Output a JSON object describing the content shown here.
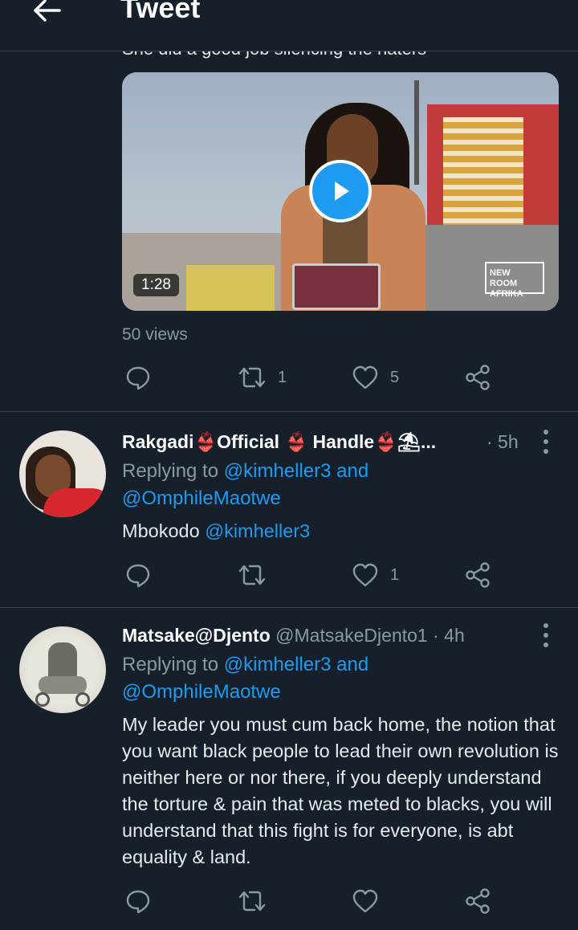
{
  "header": {
    "title": "Tweet"
  },
  "main_tweet": {
    "text_partial": "She did a good job silencing the haters",
    "video": {
      "duration": "1:28",
      "channel_logo": "NEW ROOM AFRIKA"
    },
    "views": "50 views",
    "actions": {
      "retweets": "1",
      "likes": "5"
    }
  },
  "replies": [
    {
      "display_name": "Rakgadi👙Official 👙 Handle👙⛱...",
      "time": "· 5h",
      "replying_prefix": "Replying to",
      "replying_to": "@kimheller3 and",
      "replying_to_2": "@OmphileMaotwe",
      "text": "Mbokodo",
      "text_mention": "@kimheller3",
      "actions": {
        "likes": "1"
      }
    },
    {
      "display_name": "Matsake@Djento",
      "handle": "@MatsakeDjento1",
      "time": "· 4h",
      "replying_prefix": "Replying to",
      "replying_to": "@kimheller3 and",
      "replying_to_2": "@OmphileMaotwe",
      "text": "My leader you must cum back home, the notion that you want black people to lead their own revolution is neither here or nor there, if you deeply understand the torture & pain that was meted to blacks, you will understand that this fight is for everyone, is abt equality & land."
    }
  ],
  "icons": {
    "back": "arrow-left-icon",
    "reply": "comment-icon",
    "retweet": "retweet-icon",
    "like": "heart-icon",
    "share": "share-icon",
    "more": "more-vertical-icon",
    "play": "play-icon"
  },
  "colors": {
    "background": "#15202b",
    "accent": "#1d9bf0",
    "muted": "#8b98a5",
    "divider": "#38444d"
  }
}
